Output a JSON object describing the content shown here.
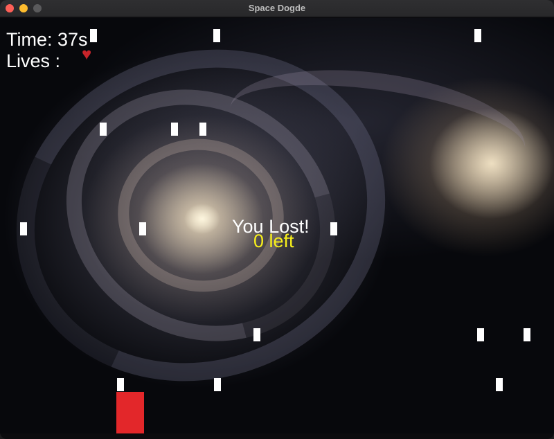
{
  "window": {
    "title": "Space Dogde"
  },
  "hud": {
    "time_text": "Time: 37s",
    "lives_label": "Lives :",
    "lives_icon": "heart-icon",
    "lives_count": 1
  },
  "game_over": {
    "message": "You Lost!",
    "remaining_text": "0 left"
  },
  "colors": {
    "player": "#e3272a",
    "asteroid": "#ffffff",
    "heart": "#c8242a",
    "remaining_text": "#f7ef1b"
  }
}
